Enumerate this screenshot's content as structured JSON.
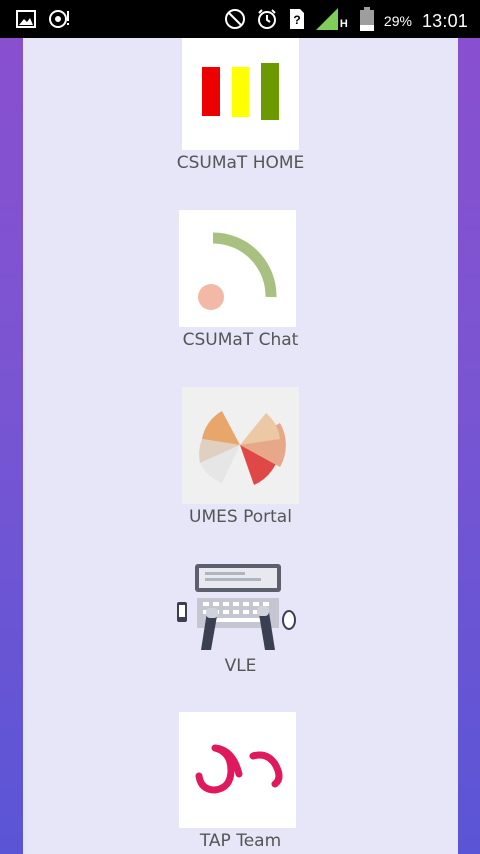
{
  "status_bar": {
    "icons_left": [
      "image-icon",
      "sync-alert-icon"
    ],
    "icons_right": [
      "do-not-disturb-icon",
      "alarm-icon",
      "unknown-sim-icon",
      "signal-icon"
    ],
    "network_type": "H",
    "battery": "29%",
    "time": "13:01"
  },
  "apps": [
    {
      "label": "CSUMaT HOME",
      "icon": "csumat-home-bars-icon"
    },
    {
      "label": "CSUMaT Chat",
      "icon": "csumat-chat-arc-icon"
    },
    {
      "label": "UMES Portal",
      "icon": "umes-portal-flower-icon"
    },
    {
      "label": "VLE",
      "icon": "vle-laptop-icon"
    },
    {
      "label": "TAP Team",
      "icon": "tap-team-logo-icon"
    }
  ],
  "colors": {
    "panel": "#e6e6f8",
    "gradient_top": "#8a4fcf",
    "gradient_bottom": "#5a55d6",
    "label": "#555555"
  }
}
